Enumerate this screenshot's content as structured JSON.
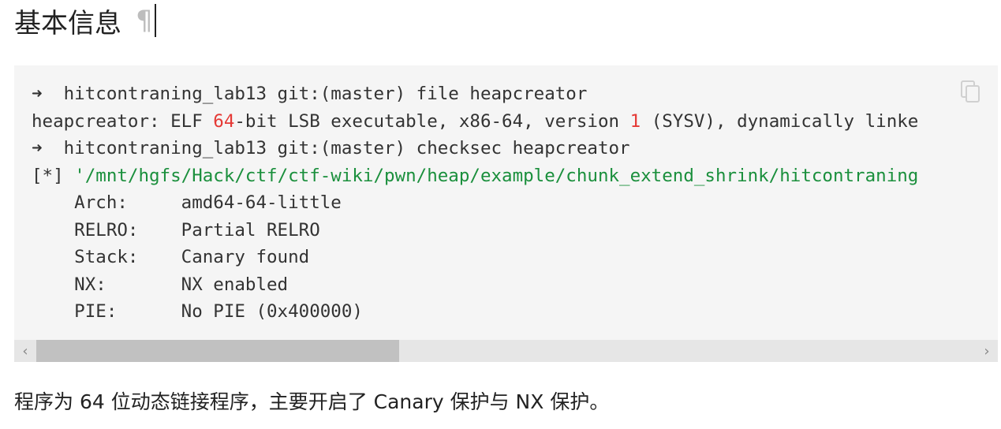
{
  "heading": {
    "title": "基本信息",
    "pilcrow": "¶"
  },
  "code_block": {
    "lines": [
      {
        "parts": [
          {
            "t": "➜",
            "c": "arrow"
          },
          {
            "t": "  hitcontraning_lab13 git:(master) file heapcreator"
          }
        ]
      },
      {
        "parts": [
          {
            "t": "heapcreator: ELF "
          },
          {
            "t": "64",
            "c": "num"
          },
          {
            "t": "-bit LSB executable, x86-64, version "
          },
          {
            "t": "1",
            "c": "num"
          },
          {
            "t": " (SYSV), dynamically linke"
          }
        ]
      },
      {
        "parts": [
          {
            "t": "➜",
            "c": "arrow"
          },
          {
            "t": "  hitcontraning_lab13 git:(master) checksec heapcreator"
          }
        ]
      },
      {
        "parts": [
          {
            "t": "[*] "
          },
          {
            "t": "'/mnt/hgfs/Hack/ctf/ctf-wiki/pwn/heap/example/chunk_extend_shrink/hitcontraning",
            "c": "str"
          }
        ]
      },
      {
        "parts": [
          {
            "t": "    Arch:     amd64-64-little"
          }
        ]
      },
      {
        "parts": [
          {
            "t": "    RELRO:    Partial RELRO"
          }
        ]
      },
      {
        "parts": [
          {
            "t": "    Stack:    Canary found"
          }
        ]
      },
      {
        "parts": [
          {
            "t": "    NX:       NX enabled"
          }
        ]
      },
      {
        "parts": [
          {
            "t": "    PIE:      No PIE (0x400000)"
          }
        ]
      }
    ],
    "copy_icon": "copy-icon",
    "scroll_left_glyph": "‹",
    "scroll_right_glyph": "›"
  },
  "paragraph": "程序为 64 位动态链接程序，主要开启了 Canary 保护与 NX 保护。",
  "colors": {
    "number": "#e53935",
    "string": "#1a8f3c",
    "code_bg": "#f5f5f5"
  }
}
